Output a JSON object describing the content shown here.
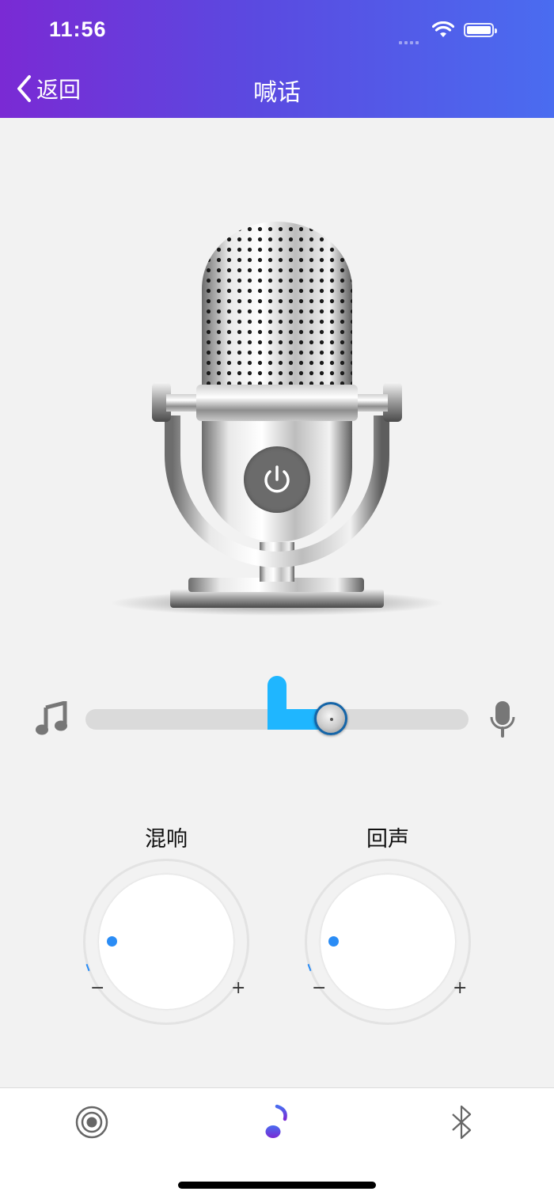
{
  "status_bar": {
    "time": "11:56"
  },
  "nav": {
    "back_label": "返回",
    "title": "喊话"
  },
  "slider": {
    "value": 0.64
  },
  "knobs": [
    {
      "label": "混响",
      "min_label": "−",
      "max_label": "+",
      "value": 0
    },
    {
      "label": "回声",
      "min_label": "−",
      "max_label": "+",
      "value": 0
    }
  ],
  "tabbar": {
    "tabs": [
      {
        "icon": "target-icon",
        "active": false
      },
      {
        "icon": "music-note-icon",
        "active": true
      },
      {
        "icon": "bluetooth-icon",
        "active": false
      }
    ],
    "active_color": "#4a3fe0"
  },
  "colors": {
    "header_start": "#7a2ad4",
    "header_end": "#4a6cf0",
    "slider_accent": "#1fb6ff",
    "knob_dot": "#2a8cf5"
  }
}
